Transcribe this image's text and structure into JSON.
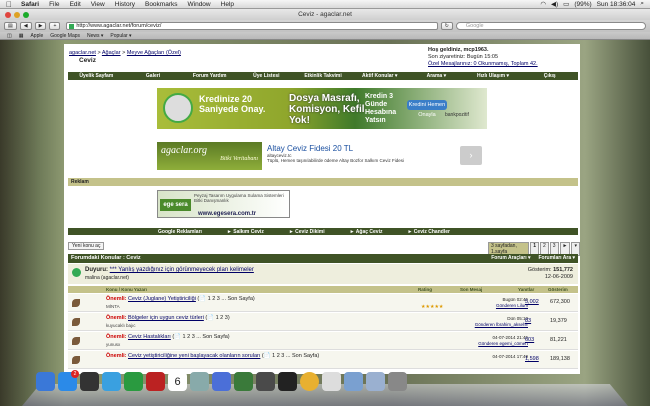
{
  "menubar": {
    "apple": "",
    "app_name": "Safari",
    "items": [
      "File",
      "Edit",
      "View",
      "History",
      "Bookmarks",
      "Window",
      "Help"
    ],
    "battery": "(99%)",
    "clock": "Sun 18:36:04"
  },
  "window": {
    "title": "Ceviz - agaclar.net"
  },
  "toolbar": {
    "url": "http://www.agaclar.net/forum/ceviz/",
    "search_placeholder": "Google"
  },
  "bookmarks": [
    "Apple",
    "Google Maps",
    "News ▾",
    "Popular ▾"
  ],
  "forum": {
    "breadcrumb": [
      "agaclar.net",
      "Ağaçlar",
      "Meyve Ağaçları (Özel)"
    ],
    "page_title": "Ceviz",
    "welcome_title": "Hoş geldiniz, mcp1963.",
    "last_visit": "Son ziyaretiniz: Bugün 15:05",
    "messages": "Özel Mesajlarınız: 0 Okunmamış, Toplam 42.",
    "nav": [
      "Üyelik Sayfam",
      "Galeri",
      "Forum Yardım",
      "Üye Listesi",
      "Etkinlik Takvimi",
      "Aktif Konular ▾",
      "Arama ▾",
      "Hızlı Ulaşım ▾",
      "Çıkış"
    ]
  },
  "ads": {
    "ad1": {
      "left": "Kredinize 20 Saniyede Onay.",
      "mid": "Dosya Masrafı, Komisyon, Kefil Yok!",
      "right": "Kredin 3 Günde Hesabına Yatsın",
      "button": "Kredini Hemen Onayla",
      "bank": "bankpozitif"
    },
    "ad2": {
      "logo": "agaclar.org",
      "logo_sub": "Bitki Veritabanı",
      "title": "Altay Ceviz Fidesi 20 TL",
      "site": "altayceviz.tc",
      "desc": "Tüplü, Hemen taşınılabilirde ödeme Altay Bozfor Salkım Ceviz Fidesi"
    },
    "ad3": {
      "logo": "ege sera",
      "text": "Peyzaj Tasarım Uygulama Sulama Sistemleri Bitki Danışmanlık",
      "url": "www.egesera.com.tr"
    }
  },
  "reklam_label": "Reklam",
  "google_bar": [
    "Google Reklamları",
    "► Salkım Ceviz",
    "► Ceviz Dikimi",
    "► Ağaç Ceviz",
    "► Ceviz Chandler"
  ],
  "new_topic": "Yeni konu aç",
  "pager": {
    "info": "3 sayfadan, 1.sayfa",
    "pages": [
      "1",
      "2",
      "3",
      "►",
      "▾"
    ]
  },
  "forum_header": {
    "title": "Forumdaki Konular : Ceviz",
    "tools": "Forum Araçları ▾",
    "search": "Forumları Ara ▾"
  },
  "announcement": {
    "label": "Duyuru:",
    "link": "*** Yanlış yazdığınız için görünmeyecek plan kelimeler",
    "author": "malina (agaclar.net)",
    "views_label": "Gösterim:",
    "views": "151,772",
    "date": "12-06-2009"
  },
  "columns": {
    "topic": "Konu / Konu Yazarı",
    "rating": "Rating",
    "last": "Son Mesaj",
    "replies": "Yanıtlar",
    "views": "Gösterim"
  },
  "threads": [
    {
      "prefix": "Önemli:",
      "title": "Ceviz (Juglane) Yetiştiriciliği",
      "pages": "(📄 1 2 3 ... Son Sayfa)",
      "author": "MİNTA",
      "rating": "★★★★★",
      "last_date": "Bugün 02:45",
      "last_by": "Gönderen Lilum",
      "replies": "5,002",
      "views": "672,300"
    },
    {
      "prefix": "Önemli:",
      "title": "Bölgeler için uygun ceviz türleri",
      "pages": "(📄 1 2 3)",
      "author": "kuyucaklı bajıc",
      "rating": "",
      "last_date": "Dün 05:10",
      "last_by": "Gönderen İbrahim_aksehir",
      "replies": "83",
      "views": "19,379"
    },
    {
      "prefix": "Önemli:",
      "title": "Ceviz Hastalıkları",
      "pages": "(📄 1 2 3 ... Son Sayfa)",
      "author": "yunusx",
      "rating": "",
      "last_date": "04-07-2014 21:45",
      "last_by": "Gönderen egemi_cömert",
      "replies": "603",
      "views": "81,221"
    },
    {
      "prefix": "Önemli:",
      "title": "Ceviz yetiştiriciliğine yeni başlayacak olanların soruları",
      "pages": "(📄 1 2 3 ... Son Sayfa)",
      "author": "",
      "rating": "",
      "last_date": "04-07-2014 17:49",
      "last_by": "",
      "replies": "1,598",
      "views": "189,138"
    }
  ],
  "dock": {
    "apps": [
      "finder-icon",
      "app-store-icon",
      "dashboard-icon",
      "safari-icon",
      "facetime-icon",
      "photo-booth-icon",
      "calendar-icon",
      "preview-icon",
      "itunes-icon",
      "iphoto-icon",
      "time-machine-icon",
      "mission-control-icon",
      "chrome-icon",
      "mail-icon",
      "downloads-icon",
      "documents-icon",
      "trash-icon"
    ],
    "calendar_day": "6",
    "badge": "2",
    "colors": [
      "#3a78d8",
      "#2b8ae8",
      "#333",
      "#3aa0e0",
      "#2a9a40",
      "#b22",
      "#fff",
      "#8aa",
      "#4b6fd8",
      "#3a7a3a",
      "#4a4a4a",
      "#222",
      "#e8b030",
      "#ddd",
      "#7aa0d0",
      "#9ab0d0",
      "#888"
    ]
  }
}
